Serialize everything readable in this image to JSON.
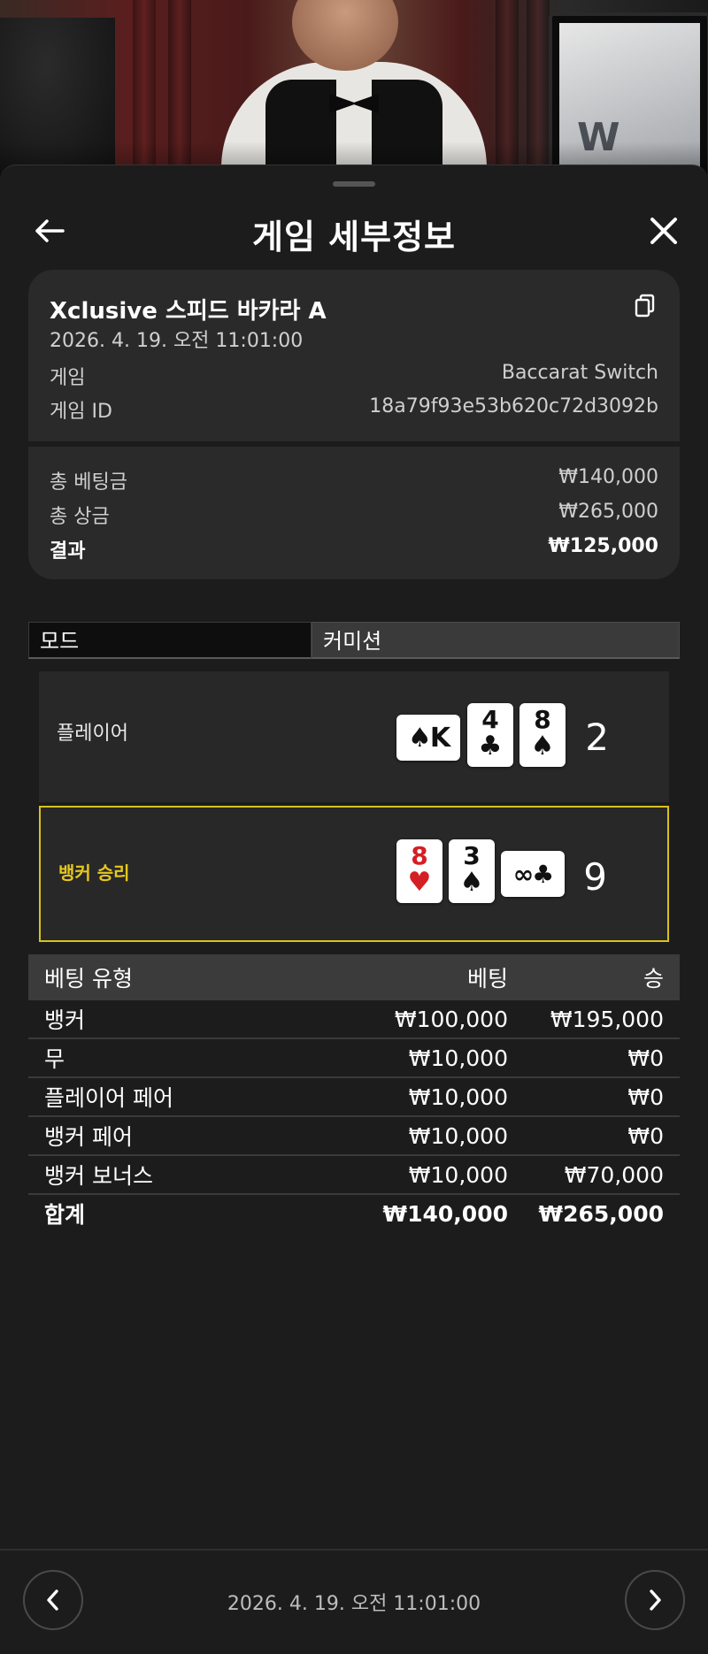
{
  "header": {
    "title": "게임 세부정보"
  },
  "summary": {
    "game_name": "Xclusive 스피드 바카라 A",
    "date": "2026. 4. 19. 오전 11:01:00",
    "game_label": "게임",
    "game_value": "Baccarat Switch",
    "game_id_label": "게임 ID",
    "game_id_value": "18a79f93e53b620c72d3092b",
    "total_bet_label": "총 베팅금",
    "total_bet_value": "₩140,000",
    "total_win_label": "총 상금",
    "total_win_value": "₩265,000",
    "result_label": "결과",
    "result_value": "₩125,000"
  },
  "tabs": [
    {
      "label": "모드",
      "active": true
    },
    {
      "label": "커미션",
      "active": false
    }
  ],
  "player_hand": {
    "label": "플레이어",
    "score": "2",
    "cards": [
      {
        "rank": "K",
        "suit": "♠",
        "color": "black",
        "orientation": "horizontal"
      },
      {
        "rank": "4",
        "suit": "♣",
        "color": "black",
        "orientation": "vertical"
      },
      {
        "rank": "8",
        "suit": "♠",
        "color": "black",
        "orientation": "vertical"
      }
    ]
  },
  "banker_hand": {
    "label": "뱅커 승리",
    "score": "9",
    "highlight_color": "#d7c21e",
    "cards": [
      {
        "rank": "8",
        "suit": "♥",
        "color": "red",
        "orientation": "vertical"
      },
      {
        "rank": "3",
        "suit": "♠",
        "color": "black",
        "orientation": "vertical"
      },
      {
        "rank": "8",
        "suit": "♣",
        "color": "black",
        "orientation": "horizontal"
      }
    ]
  },
  "bets": {
    "headers": {
      "type": "베팅 유형",
      "bet": "베팅",
      "win": "승"
    },
    "rows": [
      {
        "type": "뱅커",
        "bet": "₩100,000",
        "win": "₩195,000"
      },
      {
        "type": "무",
        "bet": "₩10,000",
        "win": "₩0"
      },
      {
        "type": "플레이어 페어",
        "bet": "₩10,000",
        "win": "₩0"
      },
      {
        "type": "뱅커 페어",
        "bet": "₩10,000",
        "win": "₩0"
      },
      {
        "type": "뱅커 보너스",
        "bet": "₩10,000",
        "win": "₩70,000"
      }
    ],
    "total": {
      "type": "합계",
      "bet": "₩140,000",
      "win": "₩265,000"
    }
  },
  "footer": {
    "date": "2026. 4. 19. 오전 11:01:00"
  },
  "icons": {
    "back": "arrow-left-icon",
    "close": "close-icon",
    "copy": "copy-icon",
    "prev": "chevron-left-icon",
    "next": "chevron-right-icon"
  }
}
